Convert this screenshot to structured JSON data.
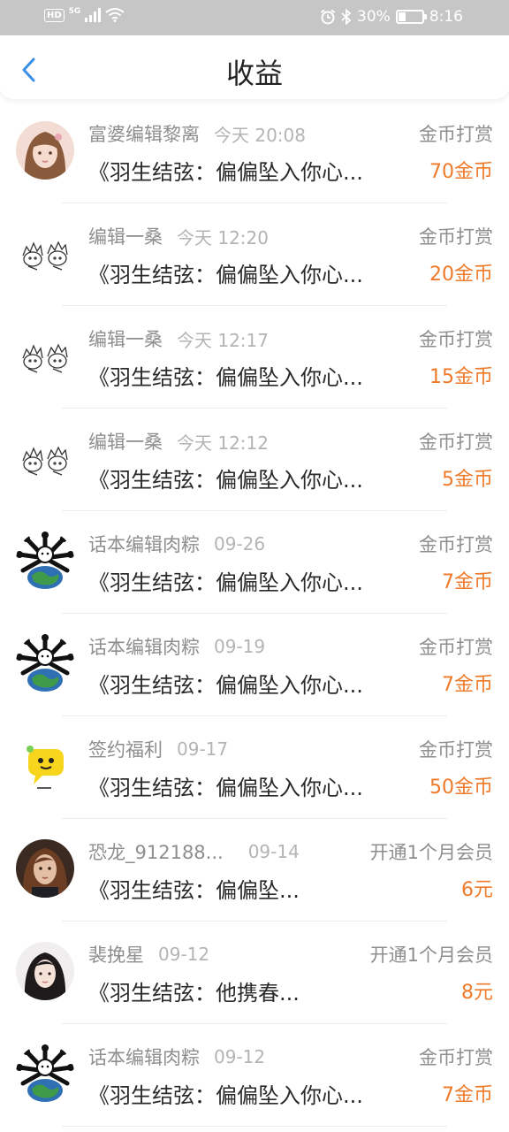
{
  "status_bar": {
    "hd": "HD",
    "network": "5G",
    "battery_percent": "30%",
    "battery_level": 0.3,
    "time": "8:16",
    "icons": [
      "signal-icon",
      "wifi-icon",
      "alarm-icon",
      "bluetooth-icon",
      "battery-icon"
    ]
  },
  "header": {
    "title": "收益",
    "back_icon": "chevron-left-icon",
    "accent_color": "#3a8ee6"
  },
  "colors": {
    "amount": "#ef7a2a",
    "meta": "#8e8e8e",
    "time": "#b4b4b4"
  },
  "records": [
    {
      "name": "富婆编辑黎离",
      "time": "今天 20:08",
      "type": "金币打赏",
      "work": "《羽生结弦：偏偏坠入你心...",
      "amount": "70金币",
      "avatar": "portrait-girl"
    },
    {
      "name": "编辑一桑",
      "time": "今天 12:20",
      "type": "金币打赏",
      "work": "《羽生结弦：偏偏坠入你心...",
      "amount": "20金币",
      "avatar": "sketch"
    },
    {
      "name": "编辑一桑",
      "time": "今天 12:17",
      "type": "金币打赏",
      "work": "《羽生结弦：偏偏坠入你心...",
      "amount": "15金币",
      "avatar": "sketch"
    },
    {
      "name": "编辑一桑",
      "time": "今天 12:12",
      "type": "金币打赏",
      "work": "《羽生结弦：偏偏坠入你心...",
      "amount": "5金币",
      "avatar": "sketch"
    },
    {
      "name": "话本编辑肉粽",
      "time": "09-26",
      "type": "金币打赏",
      "work": "《羽生结弦：偏偏坠入你心...",
      "amount": "7金币",
      "avatar": "globe"
    },
    {
      "name": "话本编辑肉粽",
      "time": "09-19",
      "type": "金币打赏",
      "work": "《羽生结弦：偏偏坠入你心...",
      "amount": "7金币",
      "avatar": "globe"
    },
    {
      "name": "签约福利",
      "time": "09-17",
      "type": "金币打赏",
      "work": "《羽生结弦：偏偏坠入你心...",
      "amount": "50金币",
      "avatar": "chat-bubble"
    },
    {
      "name": "恐龙_912188...",
      "time": "09-14",
      "type": "开通1个月会员",
      "work": "《羽生结弦：偏偏坠...",
      "amount": "6元",
      "avatar": "portrait-brown"
    },
    {
      "name": "裴挽星",
      "time": "09-12",
      "type": "开通1个月会员",
      "work": "《羽生结弦：他携春...",
      "amount": "8元",
      "avatar": "portrait-dark"
    },
    {
      "name": "话本编辑肉粽",
      "time": "09-12",
      "type": "金币打赏",
      "work": "《羽生结弦：偏偏坠入你心...",
      "amount": "7金币",
      "avatar": "globe"
    }
  ]
}
